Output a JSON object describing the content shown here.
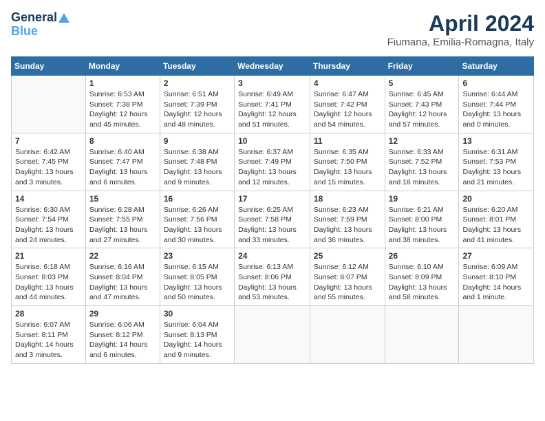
{
  "logo": {
    "line1": "General",
    "line2": "Blue"
  },
  "title": "April 2024",
  "subtitle": "Fiumana, Emilia-Romagna, Italy",
  "days_header": [
    "Sunday",
    "Monday",
    "Tuesday",
    "Wednesday",
    "Thursday",
    "Friday",
    "Saturday"
  ],
  "weeks": [
    [
      {
        "num": "",
        "info": ""
      },
      {
        "num": "1",
        "info": "Sunrise: 6:53 AM\nSunset: 7:38 PM\nDaylight: 12 hours\nand 45 minutes."
      },
      {
        "num": "2",
        "info": "Sunrise: 6:51 AM\nSunset: 7:39 PM\nDaylight: 12 hours\nand 48 minutes."
      },
      {
        "num": "3",
        "info": "Sunrise: 6:49 AM\nSunset: 7:41 PM\nDaylight: 12 hours\nand 51 minutes."
      },
      {
        "num": "4",
        "info": "Sunrise: 6:47 AM\nSunset: 7:42 PM\nDaylight: 12 hours\nand 54 minutes."
      },
      {
        "num": "5",
        "info": "Sunrise: 6:45 AM\nSunset: 7:43 PM\nDaylight: 12 hours\nand 57 minutes."
      },
      {
        "num": "6",
        "info": "Sunrise: 6:44 AM\nSunset: 7:44 PM\nDaylight: 13 hours\nand 0 minutes."
      }
    ],
    [
      {
        "num": "7",
        "info": "Sunrise: 6:42 AM\nSunset: 7:45 PM\nDaylight: 13 hours\nand 3 minutes."
      },
      {
        "num": "8",
        "info": "Sunrise: 6:40 AM\nSunset: 7:47 PM\nDaylight: 13 hours\nand 6 minutes."
      },
      {
        "num": "9",
        "info": "Sunrise: 6:38 AM\nSunset: 7:48 PM\nDaylight: 13 hours\nand 9 minutes."
      },
      {
        "num": "10",
        "info": "Sunrise: 6:37 AM\nSunset: 7:49 PM\nDaylight: 13 hours\nand 12 minutes."
      },
      {
        "num": "11",
        "info": "Sunrise: 6:35 AM\nSunset: 7:50 PM\nDaylight: 13 hours\nand 15 minutes."
      },
      {
        "num": "12",
        "info": "Sunrise: 6:33 AM\nSunset: 7:52 PM\nDaylight: 13 hours\nand 18 minutes."
      },
      {
        "num": "13",
        "info": "Sunrise: 6:31 AM\nSunset: 7:53 PM\nDaylight: 13 hours\nand 21 minutes."
      }
    ],
    [
      {
        "num": "14",
        "info": "Sunrise: 6:30 AM\nSunset: 7:54 PM\nDaylight: 13 hours\nand 24 minutes."
      },
      {
        "num": "15",
        "info": "Sunrise: 6:28 AM\nSunset: 7:55 PM\nDaylight: 13 hours\nand 27 minutes."
      },
      {
        "num": "16",
        "info": "Sunrise: 6:26 AM\nSunset: 7:56 PM\nDaylight: 13 hours\nand 30 minutes."
      },
      {
        "num": "17",
        "info": "Sunrise: 6:25 AM\nSunset: 7:58 PM\nDaylight: 13 hours\nand 33 minutes."
      },
      {
        "num": "18",
        "info": "Sunrise: 6:23 AM\nSunset: 7:59 PM\nDaylight: 13 hours\nand 36 minutes."
      },
      {
        "num": "19",
        "info": "Sunrise: 6:21 AM\nSunset: 8:00 PM\nDaylight: 13 hours\nand 38 minutes."
      },
      {
        "num": "20",
        "info": "Sunrise: 6:20 AM\nSunset: 8:01 PM\nDaylight: 13 hours\nand 41 minutes."
      }
    ],
    [
      {
        "num": "21",
        "info": "Sunrise: 6:18 AM\nSunset: 8:03 PM\nDaylight: 13 hours\nand 44 minutes."
      },
      {
        "num": "22",
        "info": "Sunrise: 6:16 AM\nSunset: 8:04 PM\nDaylight: 13 hours\nand 47 minutes."
      },
      {
        "num": "23",
        "info": "Sunrise: 6:15 AM\nSunset: 8:05 PM\nDaylight: 13 hours\nand 50 minutes."
      },
      {
        "num": "24",
        "info": "Sunrise: 6:13 AM\nSunset: 8:06 PM\nDaylight: 13 hours\nand 53 minutes."
      },
      {
        "num": "25",
        "info": "Sunrise: 6:12 AM\nSunset: 8:07 PM\nDaylight: 13 hours\nand 55 minutes."
      },
      {
        "num": "26",
        "info": "Sunrise: 6:10 AM\nSunset: 8:09 PM\nDaylight: 13 hours\nand 58 minutes."
      },
      {
        "num": "27",
        "info": "Sunrise: 6:09 AM\nSunset: 8:10 PM\nDaylight: 14 hours\nand 1 minute."
      }
    ],
    [
      {
        "num": "28",
        "info": "Sunrise: 6:07 AM\nSunset: 8:11 PM\nDaylight: 14 hours\nand 3 minutes."
      },
      {
        "num": "29",
        "info": "Sunrise: 6:06 AM\nSunset: 8:12 PM\nDaylight: 14 hours\nand 6 minutes."
      },
      {
        "num": "30",
        "info": "Sunrise: 6:04 AM\nSunset: 8:13 PM\nDaylight: 14 hours\nand 9 minutes."
      },
      {
        "num": "",
        "info": ""
      },
      {
        "num": "",
        "info": ""
      },
      {
        "num": "",
        "info": ""
      },
      {
        "num": "",
        "info": ""
      }
    ]
  ]
}
